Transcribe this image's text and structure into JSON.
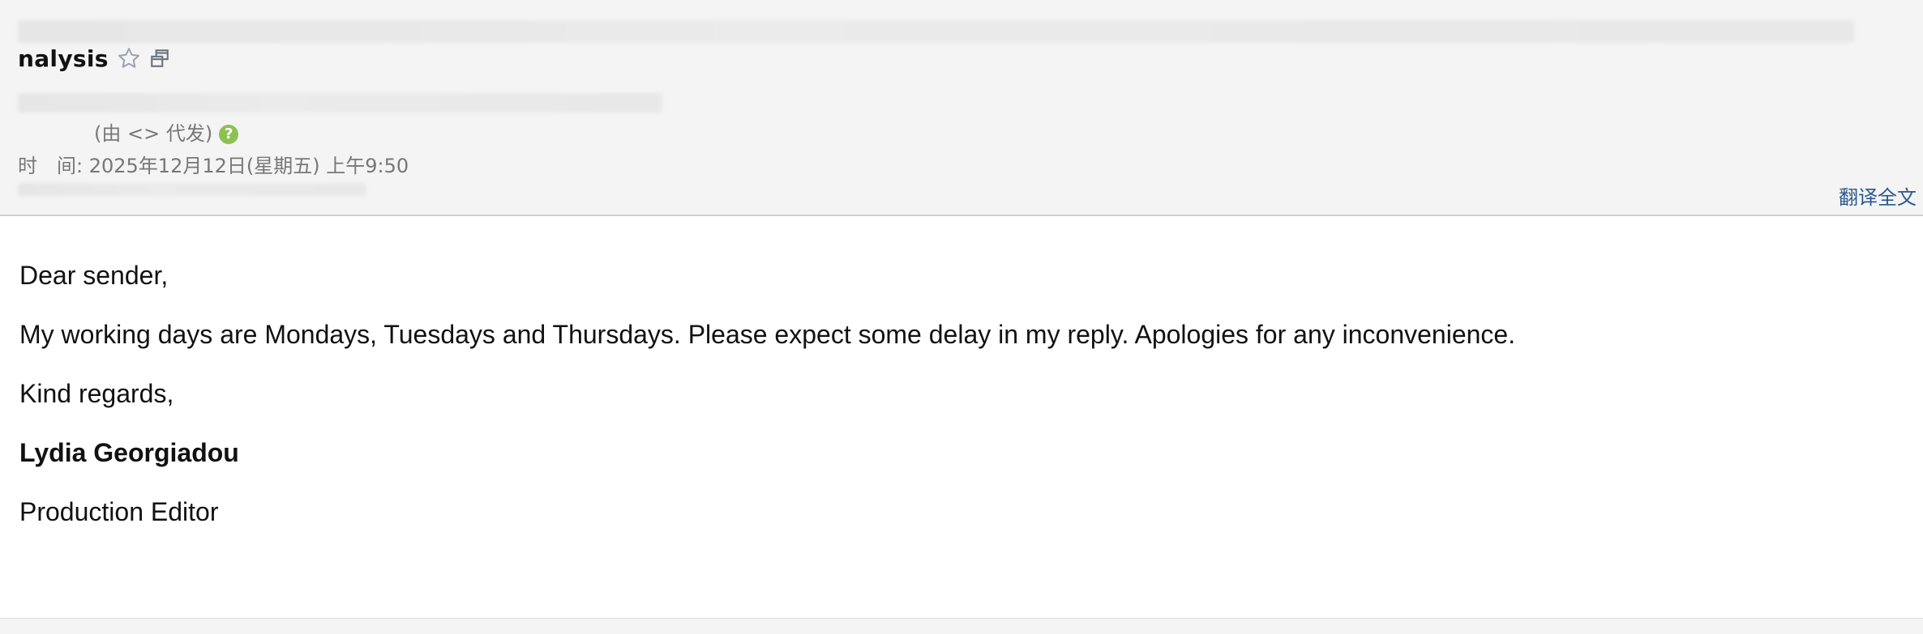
{
  "header": {
    "subject": "nalysis",
    "star_icon": "star-outline-icon",
    "popout_icon": "open-in-new-window-icon",
    "sender_via": "(由 <> 代发)",
    "help_icon_glyph": "?",
    "time_label": "时　间:",
    "time_value": "2025年12月12日(星期五) 上午9:50",
    "translate_label": "翻译全文",
    "accent_color": "#2a5a8c",
    "help_color": "#8cc152"
  },
  "body": {
    "greeting": "Dear sender,",
    "message": "My working days are Mondays, Tuesdays and Thursdays. Please expect some delay in my reply. Apologies for any inconvenience.",
    "closing": "Kind regards,",
    "signature_name": "Lydia Georgiadou",
    "signature_title": "Production Editor"
  }
}
